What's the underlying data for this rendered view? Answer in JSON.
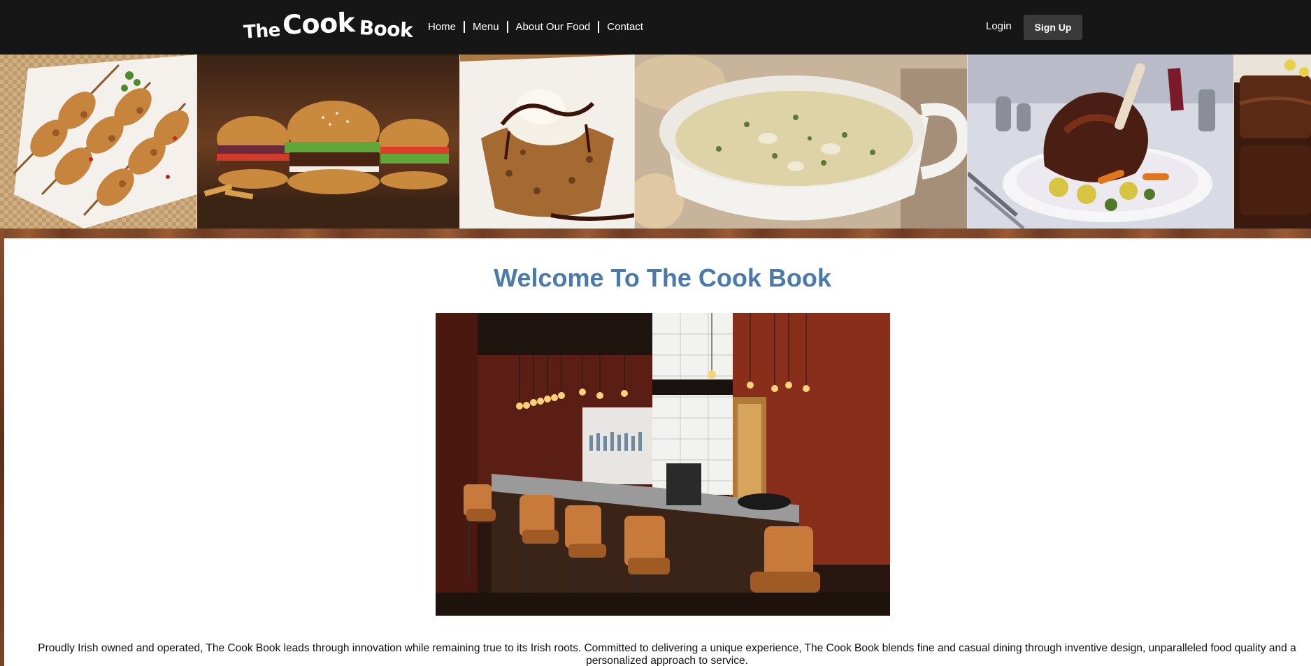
{
  "header": {
    "logo": {
      "word1": "The",
      "word2": "Cook",
      "word3": "Book"
    },
    "nav": [
      {
        "label": "Home"
      },
      {
        "label": "Menu"
      },
      {
        "label": "About Our Food"
      },
      {
        "label": "Contact"
      }
    ],
    "login_label": "Login",
    "signup_label": "Sign Up"
  },
  "banner": {
    "images": [
      "chicken-skewers-image",
      "burgers-image",
      "cookie-sundae-image",
      "soup-bowl-image",
      "roast-rib-image",
      "chocolate-dessert-image"
    ]
  },
  "main": {
    "title": "Welcome To The Cook Book",
    "hero_image": "restaurant-bar-interior-image",
    "intro": "Proudly Irish owned and operated, The Cook Book leads through innovation while remaining true to its Irish roots. Committed to delivering a unique experience, The Cook Book blends fine and casual dining through inventive design, unparalleled food quality and a personalized approach to service."
  },
  "colors": {
    "header_bg": "#161616",
    "title_blue": "#4a7aaa",
    "signup_bg": "#3a3a3a",
    "wood": "#7a4427"
  }
}
